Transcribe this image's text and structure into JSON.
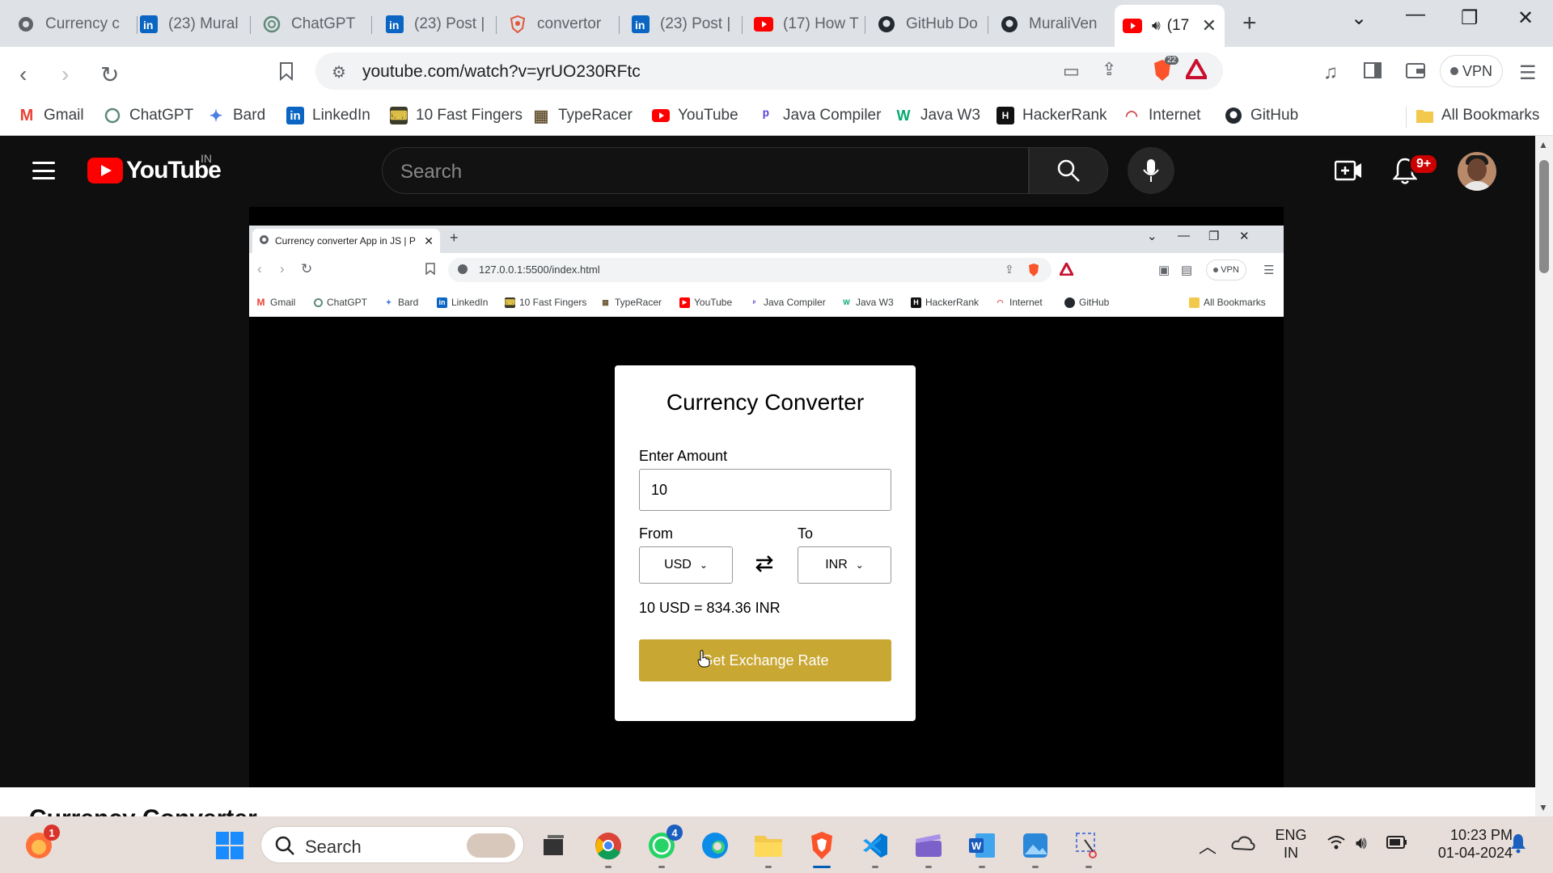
{
  "browser": {
    "tabs": [
      {
        "title": "Currency c",
        "icon": "globe-icon"
      },
      {
        "title": "(23) Mural",
        "icon": "linkedin-icon"
      },
      {
        "title": "ChatGPT",
        "icon": "chatgpt-icon"
      },
      {
        "title": "(23) Post |",
        "icon": "linkedin-icon"
      },
      {
        "title": "convertor",
        "icon": "brave-search-icon"
      },
      {
        "title": "(23) Post |",
        "icon": "linkedin-icon"
      },
      {
        "title": "(17) How T",
        "icon": "youtube-icon"
      },
      {
        "title": "GitHub Do",
        "icon": "github-icon"
      },
      {
        "title": "MuraliVen",
        "icon": "github-icon"
      },
      {
        "title": "(17",
        "icon": "youtube-icon",
        "active": true
      }
    ],
    "url": "youtube.com/watch?v=yrUO230RFtc",
    "brave_shield_count": "22",
    "vpn_label": "VPN",
    "bookmarks": [
      {
        "label": "Gmail",
        "icon": "gmail-icon"
      },
      {
        "label": "ChatGPT",
        "icon": "chatgpt-icon"
      },
      {
        "label": "Bard",
        "icon": "bard-icon"
      },
      {
        "label": "LinkedIn",
        "icon": "linkedin-icon"
      },
      {
        "label": "10 Fast Fingers",
        "icon": "fastfingers-icon"
      },
      {
        "label": "TypeRacer",
        "icon": "typeracer-icon"
      },
      {
        "label": "YouTube",
        "icon": "youtube-icon"
      },
      {
        "label": "Java Compiler",
        "icon": "java-compiler-icon"
      },
      {
        "label": "Java W3",
        "icon": "w3-icon"
      },
      {
        "label": "HackerRank",
        "icon": "hackerrank-icon"
      },
      {
        "label": "Internet",
        "icon": "internet-icon"
      },
      {
        "label": "GitHub",
        "icon": "github-icon"
      }
    ],
    "all_bookmarks_label": "All Bookmarks"
  },
  "youtube": {
    "logo_text": "YouTube",
    "region": "IN",
    "search_placeholder": "Search",
    "notification_count": "9+",
    "below_title": "Currency Converter",
    "colors": {
      "brand": "#ff0000",
      "background": "#0f0f0f"
    }
  },
  "video": {
    "inner_tab_title": "Currency converter App in JS | P",
    "inner_url": "127.0.0.1:5500/index.html",
    "inner_vpn_label": "VPN",
    "inner_bookmarks": [
      "Gmail",
      "ChatGPT",
      "Bard",
      "LinkedIn",
      "10 Fast Fingers",
      "TypeRacer",
      "YouTube",
      "Java Compiler",
      "Java W3",
      "HackerRank",
      "Internet",
      "GitHub"
    ],
    "inner_all_bookmarks": "All Bookmarks",
    "app": {
      "title": "Currency Converter",
      "amount_label": "Enter Amount",
      "amount_value": "10",
      "from_label": "From",
      "to_label": "To",
      "from_currency": "USD",
      "to_currency": "INR",
      "result": "10 USD = 834.36 INR",
      "button_label": "Get Exchange Rate",
      "button_color": "#c9a733"
    }
  },
  "taskbar": {
    "search_placeholder": "Search",
    "firefox_badge": "1",
    "whatsapp_badge": "4",
    "lang_line1": "ENG",
    "lang_line2": "IN",
    "time": "10:23 PM",
    "date": "01-04-2024"
  }
}
